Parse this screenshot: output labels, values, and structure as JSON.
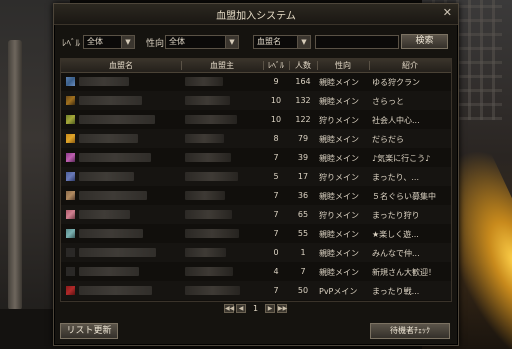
{
  "window": {
    "title": "血盟加入システム",
    "close_glyph": "✕"
  },
  "filters": {
    "level_label": "ﾚﾍﾞﾙ",
    "level_value": "全体",
    "tendency_label": "性向",
    "tendency_value": "全体",
    "search_type_value": "血盟名",
    "search_input_value": "",
    "search_button": "検索"
  },
  "table": {
    "headers": [
      "血盟名",
      "血盟主",
      "ﾚﾍﾞﾙ",
      "人数",
      "性向",
      "紹介"
    ],
    "rows": [
      {
        "level": "9",
        "members": "164",
        "tendency": "親睦メイン",
        "intro": "ゆる狩クラン",
        "emblem": [
          "#5a7fb0",
          "#3b5f8a",
          "#6a8ec0"
        ]
      },
      {
        "level": "10",
        "members": "132",
        "tendency": "親睦メイン",
        "intro": "さらっと",
        "emblem": [
          "#6b4a1a",
          "#a0701e",
          "#3c2a10"
        ]
      },
      {
        "level": "10",
        "members": "122",
        "tendency": "狩りメイン",
        "intro": "社会人中心...",
        "emblem": [
          "#6f7f2a",
          "#a5a83a",
          "#4c5a1e"
        ]
      },
      {
        "level": "8",
        "members": "79",
        "tendency": "親睦メイン",
        "intro": "だらだら",
        "emblem": [
          "#c88a1a",
          "#e0a52a",
          "#8a5a10"
        ]
      },
      {
        "level": "7",
        "members": "39",
        "tendency": "親睦メイン",
        "intro": "♪気楽に行こう♪",
        "emblem": [
          "#8a3a8a",
          "#c060b0",
          "#5a2a5a"
        ]
      },
      {
        "level": "5",
        "members": "17",
        "tendency": "狩りメイン",
        "intro": "まったり、...",
        "emblem": [
          "#4a5e9a",
          "#6a7ab8",
          "#2e3b6a"
        ]
      },
      {
        "level": "7",
        "members": "36",
        "tendency": "親睦メイン",
        "intro": "５名ぐらい募集中",
        "emblem": [
          "#8a6a4a",
          "#b08a60",
          "#5a4030"
        ]
      },
      {
        "level": "7",
        "members": "65",
        "tendency": "狩りメイン",
        "intro": "まったり狩り",
        "emblem": [
          "#b05a6a",
          "#d08090",
          "#703a46"
        ]
      },
      {
        "level": "7",
        "members": "55",
        "tendency": "親睦メイン",
        "intro": "★楽しく遊...",
        "emblem": [
          "#5a8a8a",
          "#7ab0b0",
          "#3a5a5a"
        ]
      },
      {
        "level": "0",
        "members": "1",
        "tendency": "親睦メイン",
        "intro": "みんなで仲...",
        "emblem": [
          "#2a2826",
          "#2a2826",
          "#2a2826"
        ]
      },
      {
        "level": "4",
        "members": "7",
        "tendency": "親睦メイン",
        "intro": "新規さん大歓迎！",
        "emblem": [
          "#2a2826",
          "#2a2826",
          "#2a2826"
        ]
      },
      {
        "level": "7",
        "members": "50",
        "tendency": "PvPメイン",
        "intro": "まったり戦...",
        "emblem": [
          "#8a1a1a",
          "#b02a2a",
          "#5a1010"
        ]
      }
    ]
  },
  "pager": {
    "first": "◀◀",
    "prev": "◀",
    "page": "1",
    "next": "▶",
    "last": "▶▶"
  },
  "buttons": {
    "refresh": "リスト更新",
    "waiting_check": "待機者ﾁｪｯｸ"
  },
  "colors": {
    "window_bg": "#15130f",
    "border": "#4e463a",
    "text": "#ddd4c4",
    "button": "#5b5449"
  }
}
